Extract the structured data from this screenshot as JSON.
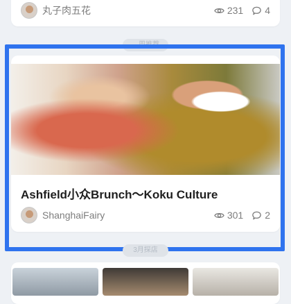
{
  "top_card": {
    "author": "丸子肉五花",
    "views": "231",
    "comments": "4"
  },
  "divider_tag_1": "…周推荐",
  "main_card": {
    "title": "Ashfield小众Brunch～Koku Culture",
    "author": "ShanghaiFairy",
    "views": "301",
    "comments": "2"
  },
  "divider_tag_2": "3月探店",
  "colors": {
    "highlight": "#2f73ee",
    "background": "#eef1f5"
  },
  "icons": [
    "eye-icon",
    "comment-icon"
  ]
}
